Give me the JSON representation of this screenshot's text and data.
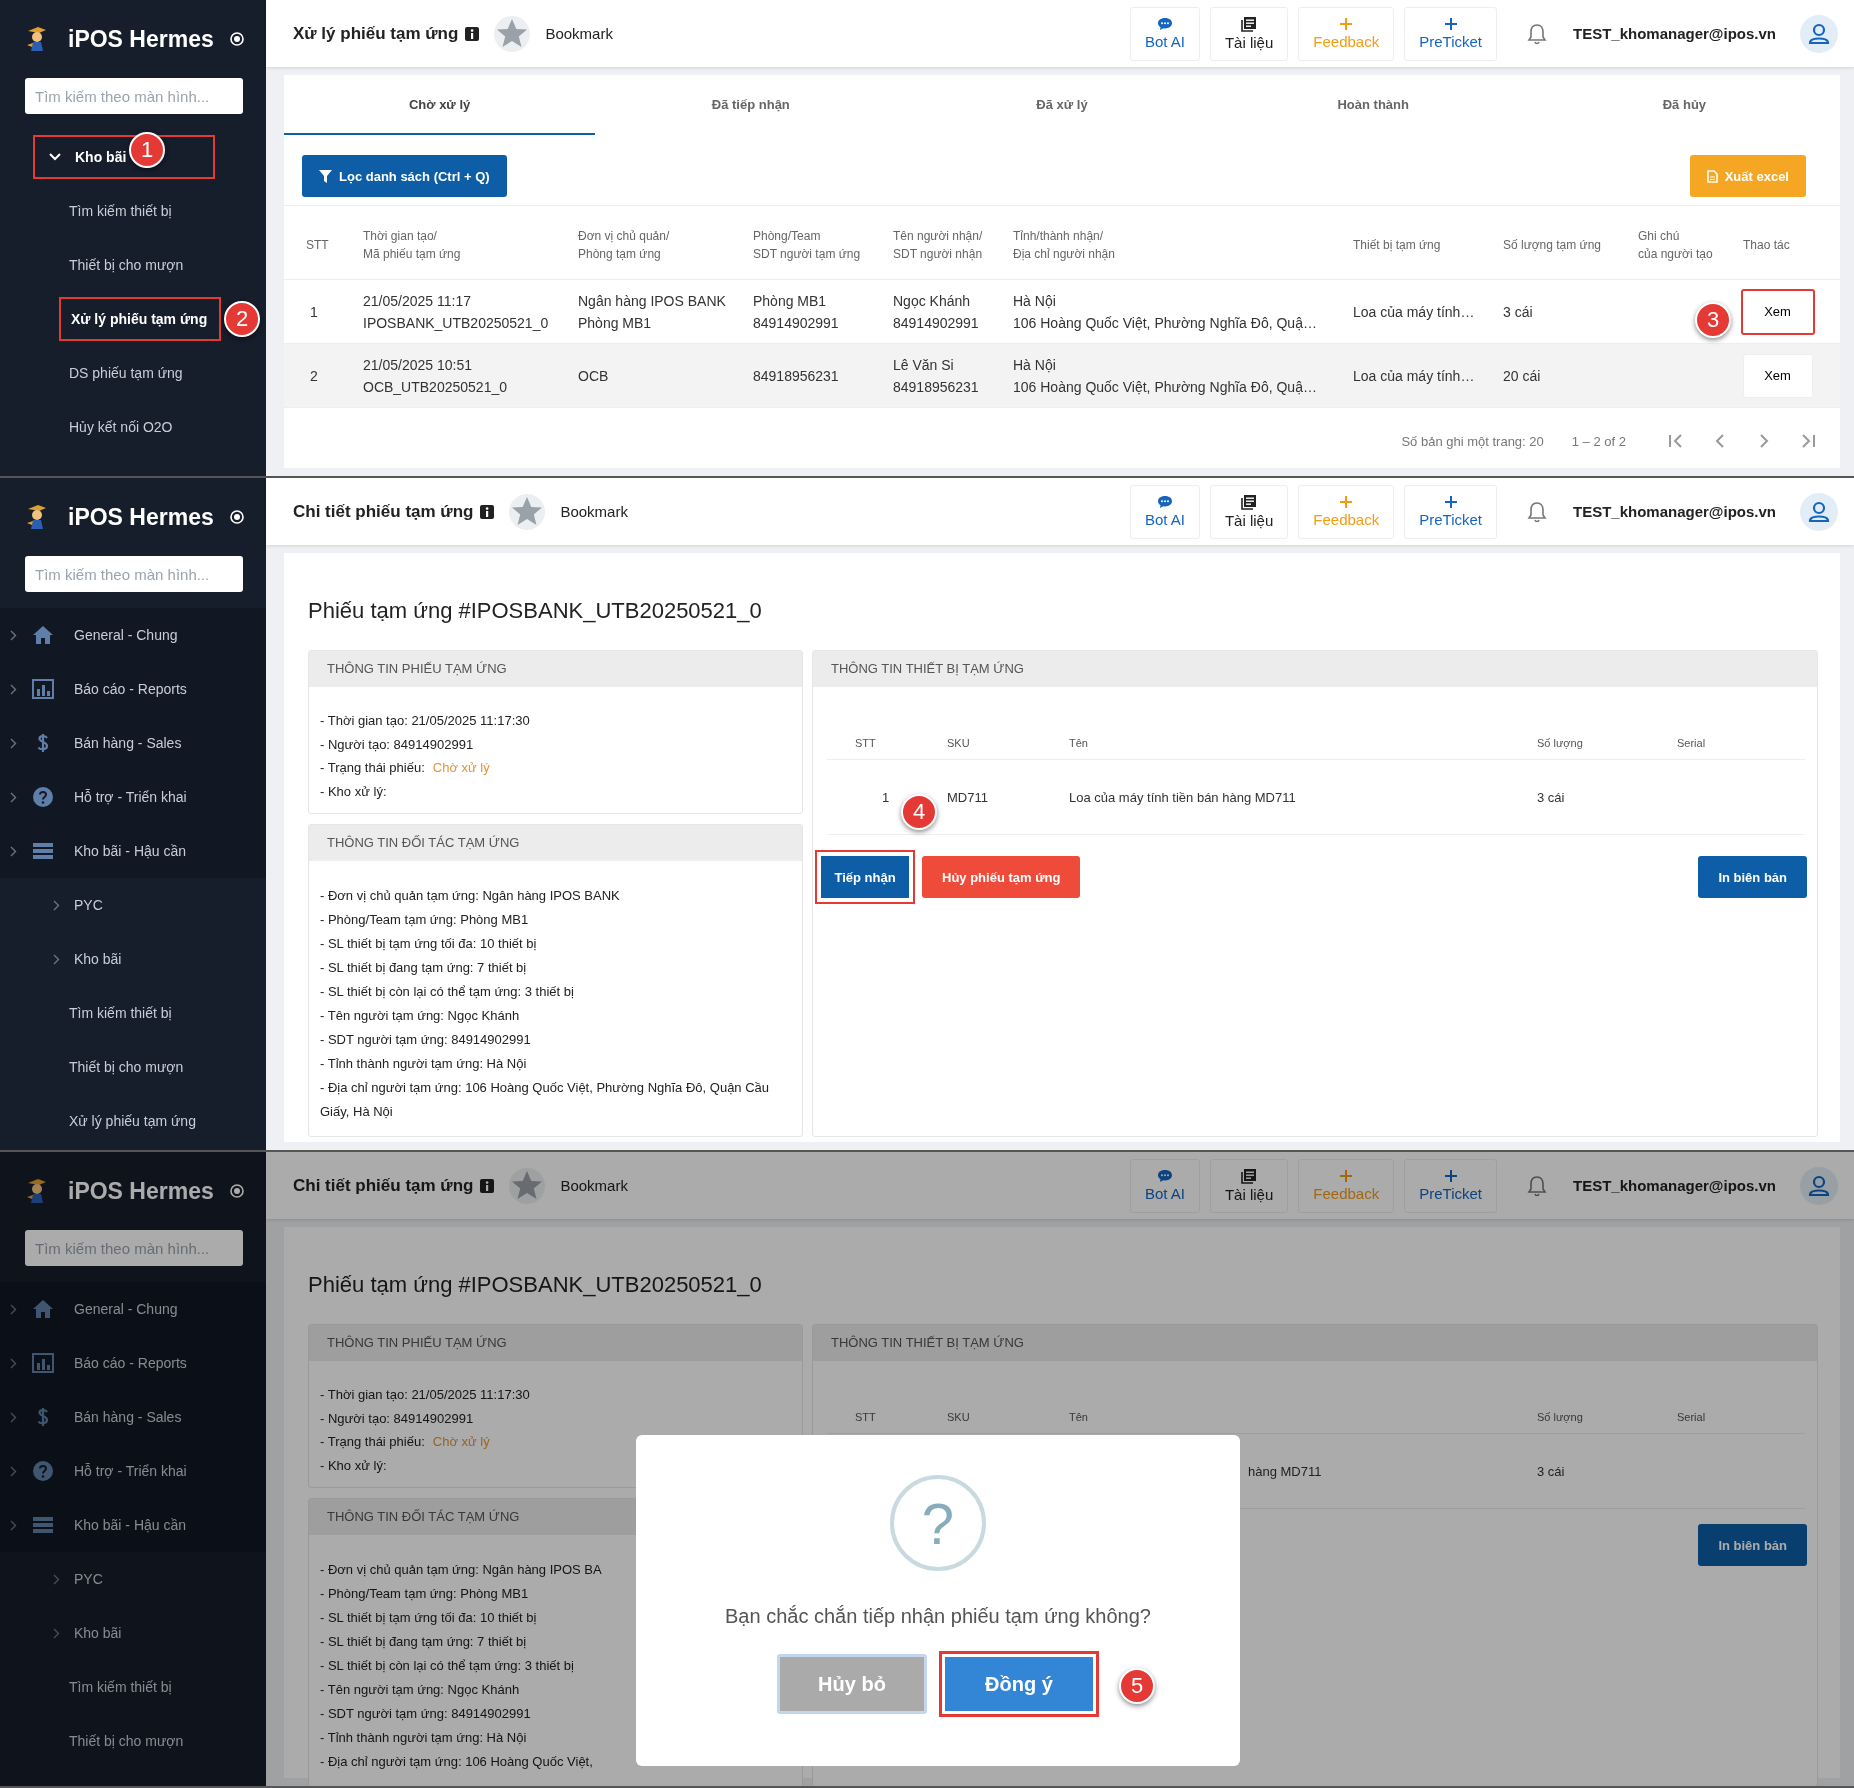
{
  "panels": [
    {
      "kind": "list",
      "dimmed": false,
      "sidebar": {
        "brand": "iPOS Hermes",
        "search_placeholder": "Tìm kiếm theo màn hình...",
        "items": [
          {
            "label": "Kho bãi",
            "kind": "group",
            "selected": true,
            "highlighted": true,
            "step": "1"
          },
          {
            "label": "Tìm kiếm thiết bị",
            "kind": "leaf",
            "selected": false,
            "highlighted": false
          },
          {
            "label": "Thiết bị cho mượn",
            "kind": "leaf",
            "selected": false,
            "highlighted": false
          },
          {
            "label": "Xử lý phiếu tạm ứng",
            "kind": "leaf",
            "selected": true,
            "highlighted": true,
            "step": "2"
          },
          {
            "label": "DS phiếu tạm ứng",
            "kind": "leaf",
            "selected": false,
            "highlighted": false
          },
          {
            "label": "Hủy kết nối O2O",
            "kind": "leaf",
            "selected": false,
            "highlighted": false
          }
        ]
      },
      "topbar": {
        "title": "Xử lý phiếu tạm ứng",
        "bookmark": "Bookmark",
        "actions": [
          {
            "label": "Bot AI",
            "kind": "chat"
          },
          {
            "label": "Tài liệu",
            "kind": "docs"
          },
          {
            "label": "Feedback",
            "kind": "feedback"
          },
          {
            "label": "PreTicket",
            "kind": "ticket"
          }
        ],
        "user": "TEST_khomanager@ipos.vn"
      },
      "tabs": [
        {
          "label": "Chờ xử lý",
          "selected": true
        },
        {
          "label": "Đã tiếp nhận",
          "selected": false
        },
        {
          "label": "Đã xử lý",
          "selected": false
        },
        {
          "label": "Hoàn thành",
          "selected": false
        },
        {
          "label": "Đã hủy",
          "selected": false
        }
      ],
      "filter_button": "Lọc danh sách (Ctrl + Q)",
      "export_button": "Xuất excel",
      "table": {
        "columns": [
          "STT",
          "Thời gian tạo/\nMã phiếu tạm ứng",
          "Đơn vị chủ quản/\nPhòng tạm ứng",
          "Phòng/Team\nSDT người tạm ứng",
          "Tên người nhận/\nSDT người nhận",
          "Tỉnh/thành nhận/\nĐịa chỉ người nhận",
          "Thiết bị tạm ứng",
          "Số lượng tạm ứng",
          "Ghi chú\ncủa người tạo",
          "Thao tác"
        ],
        "rows": [
          {
            "cells": [
              "1",
              "21/05/2025 11:17\nIPOSBANK_UTB20250521_0",
              "Ngân hàng IPOS BANK\nPhòng MB1",
              "Phòng MB1\n84914902991",
              "Ngọc Khánh\n84914902991",
              "Hà Nội\n106 Hoàng Quốc Việt, Phường Nghĩa Đô, Quậ…",
              "Loa của máy tính…",
              "3 cái"
            ],
            "action": "Xem",
            "hovered": false,
            "highlighted": true,
            "step": "3"
          },
          {
            "cells": [
              "2",
              "21/05/2025 10:51\nOCB_UTB20250521_0",
              "OCB",
              "84918956231",
              "Lê Văn Si\n84918956231",
              "Hà Nội\n106 Hoàng Quốc Việt, Phường Nghĩa Đô, Quậ…",
              "Loa của máy tính…",
              "20 cái"
            ],
            "action": "Xem",
            "hovered": true,
            "highlighted": false
          }
        ]
      },
      "pagination": {
        "page_size": "Số bản ghi một trang: 20",
        "range": "1 – 2 of 2"
      }
    },
    {
      "kind": "detail",
      "dimmed": false,
      "sidebar": {
        "brand": "iPOS Hermes",
        "search_placeholder": "Tìm kiếm theo màn hình...",
        "items": [
          {
            "label": "General - Chung",
            "kind": "module",
            "selected": false,
            "highlighted": false
          },
          {
            "label": "Báo cáo - Reports",
            "kind": "module",
            "selected": false,
            "highlighted": false
          },
          {
            "label": "Bán hàng - Sales",
            "kind": "module",
            "selected": false,
            "highlighted": false
          },
          {
            "label": "Hỗ trợ - Triển khai",
            "kind": "module",
            "selected": false,
            "highlighted": false
          },
          {
            "label": "Kho bãi - Hậu cần",
            "kind": "module",
            "selected": false,
            "highlighted": false
          },
          {
            "label": "PYC",
            "kind": "folder",
            "selected": false,
            "highlighted": false
          },
          {
            "label": "Kho bãi",
            "kind": "folder",
            "selected": false,
            "highlighted": false
          },
          {
            "label": "Tìm kiếm thiết bị",
            "kind": "leaf",
            "selected": false,
            "highlighted": false
          },
          {
            "label": "Thiết bị cho mượn",
            "kind": "leaf",
            "selected": false,
            "highlighted": false
          },
          {
            "label": "Xử lý phiếu tạm ứng",
            "kind": "leaf",
            "selected": false,
            "highlighted": false
          }
        ]
      },
      "topbar": {
        "title": "Chi tiết phiếu tạm ứng",
        "bookmark": "Bookmark",
        "actions": [
          {
            "label": "Bot AI",
            "kind": "chat"
          },
          {
            "label": "Tài liệu",
            "kind": "docs"
          },
          {
            "label": "Feedback",
            "kind": "feedback"
          },
          {
            "label": "PreTicket",
            "kind": "ticket"
          }
        ],
        "user": "TEST_khomanager@ipos.vn"
      },
      "heading": "Phiếu tạm ứng #IPOSBANK_UTB20250521_0",
      "ticket_card": {
        "title": "THÔNG TIN PHIẾU TẠM ỨNG",
        "lines": [
          {
            "text": "- Thời gian tạo: 21/05/2025 11:17:30"
          },
          {
            "text": "- Người tạo: 84914902991"
          },
          {
            "text": "- Trạng thái phiếu:",
            "status": "Chờ xử lý"
          },
          {
            "text": "- Kho xử lý:"
          }
        ]
      },
      "partner_card": {
        "title": "THÔNG TIN ĐỐI TÁC TẠM ỨNG",
        "lines": [
          {
            "text": "- Đơn vị chủ quản tạm ứng: Ngân hàng IPOS BANK"
          },
          {
            "text": "- Phòng/Team tạm ứng: Phòng MB1"
          },
          {
            "text": "- SL thiết bị tạm ứng tối đa: 10 thiết bị"
          },
          {
            "text": "- SL thiết bị đang tạm ứng: 7 thiết bị"
          },
          {
            "text": "- SL thiết bị còn lại có thể tạm ứng: 3 thiết bị"
          },
          {
            "text": "- Tên người tạm ứng: Ngọc Khánh"
          },
          {
            "text": "- SDT người tạm ứng: 84914902991"
          },
          {
            "text": "- Tỉnh thành người tạm ứng: Hà Nội"
          },
          {
            "text": "- Địa chỉ người tạm ứng: 106 Hoàng Quốc Việt, Phường Nghĩa Đô, Quận Cầu Giấy, Hà Nội"
          }
        ]
      },
      "device_card": {
        "title": "THÔNG TIN THIẾT BỊ TẠM ỨNG",
        "columns": [
          "STT",
          "SKU",
          "Tên",
          "Số lượng",
          "Serial"
        ],
        "rows": [
          {
            "stt": "1",
            "sku": "MD711",
            "name": "Loa của máy tính tiền bán hàng MD711",
            "quantity": "3 cái"
          }
        ],
        "buttons": [
          {
            "label": "Tiếp nhận",
            "kind": "accept",
            "highlighted": true,
            "step": "4"
          },
          {
            "label": "Hủy phiếu tạm ứng",
            "kind": "cancel",
            "highlighted": false
          },
          {
            "label": "In biên bản",
            "kind": "print",
            "highlighted": false
          }
        ]
      }
    },
    {
      "kind": "detail",
      "dimmed": true,
      "sidebar": {
        "brand": "iPOS Hermes",
        "search_placeholder": "Tìm kiếm theo màn hình...",
        "items": [
          {
            "label": "General - Chung",
            "kind": "module",
            "selected": false,
            "highlighted": false
          },
          {
            "label": "Báo cáo - Reports",
            "kind": "module",
            "selected": false,
            "highlighted": false
          },
          {
            "label": "Bán hàng - Sales",
            "kind": "module",
            "selected": false,
            "highlighted": false
          },
          {
            "label": "Hỗ trợ - Triển khai",
            "kind": "module",
            "selected": false,
            "highlighted": false
          },
          {
            "label": "Kho bãi - Hậu cần",
            "kind": "module",
            "selected": false,
            "highlighted": false
          },
          {
            "label": "PYC",
            "kind": "folder",
            "selected": false,
            "highlighted": false
          },
          {
            "label": "Kho bãi",
            "kind": "folder",
            "selected": false,
            "highlighted": false
          },
          {
            "label": "Tìm kiếm thiết bị",
            "kind": "leaf",
            "selected": false,
            "highlighted": false
          },
          {
            "label": "Thiết bị cho mượn",
            "kind": "leaf",
            "selected": false,
            "highlighted": false
          }
        ]
      },
      "topbar": {
        "title": "Chi tiết phiếu tạm ứng",
        "bookmark": "Bookmark",
        "actions": [
          {
            "label": "Bot AI",
            "kind": "chat"
          },
          {
            "label": "Tài liệu",
            "kind": "docs"
          },
          {
            "label": "Feedback",
            "kind": "feedback"
          },
          {
            "label": "PreTicket",
            "kind": "ticket"
          }
        ],
        "user": "TEST_khomanager@ipos.vn"
      },
      "heading": "Phiếu tạm ứng #IPOSBANK_UTB20250521_0",
      "ticket_card": {
        "title": "THÔNG TIN PHIẾU TẠM ỨNG",
        "lines": [
          {
            "text": "- Thời gian tạo: 21/05/2025 11:17:30"
          },
          {
            "text": "- Người tạo: 84914902991"
          },
          {
            "text": "- Trạng thái phiếu:",
            "status": "Chờ xử lý"
          },
          {
            "text": "- Kho xử lý:"
          }
        ]
      },
      "partner_card": {
        "title": "THÔNG TIN ĐỐI TÁC TẠM ỨNG",
        "lines": [
          {
            "text": "- Đơn vị chủ quản tạm ứng: Ngân hàng IPOS BA"
          },
          {
            "text": "- Phòng/Team tạm ứng: Phòng MB1"
          },
          {
            "text": "- SL thiết bị tạm ứng tối đa: 10 thiết bị"
          },
          {
            "text": "- SL thiết bị đang tạm ứng: 7 thiết bị"
          },
          {
            "text": "- SL thiết bị còn lại có thể tạm ứng: 3 thiết bị"
          },
          {
            "text": "- Tên người tạm ứng: Ngọc Khánh"
          },
          {
            "text": "- SDT người tạm ứng: 84914902991"
          },
          {
            "text": "- Tỉnh thành người tạm ứng: Hà Nội"
          },
          {
            "text": "- Địa chỉ người tạm ứng: 106 Hoàng Quốc Việt,"
          }
        ]
      },
      "device_card": {
        "title": "THÔNG TIN THIẾT BỊ TẠM ỨNG",
        "columns": [
          "STT",
          "SKU",
          "Tên",
          "Số lượng",
          "Serial"
        ],
        "rows": [
          {
            "name": "hàng MD711",
            "quantity": "3 cái"
          }
        ],
        "buttons": [
          {
            "label": "In biên bản",
            "kind": "print",
            "highlighted": false
          }
        ]
      },
      "dialog": {
        "icon_glyph": "?",
        "message": "Bạn chắc chắn tiếp nhận phiếu tạm ứng không?",
        "buttons": [
          {
            "label": "Hủy bỏ",
            "kind": "dismiss",
            "highlighted": false
          },
          {
            "label": "Đồng ý",
            "kind": "confirm",
            "highlighted": true,
            "step": "5"
          }
        ]
      }
    }
  ]
}
